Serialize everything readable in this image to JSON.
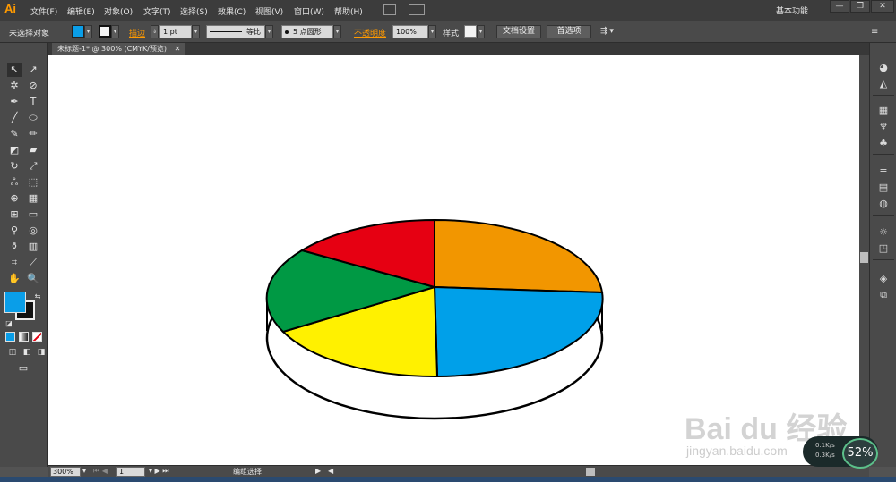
{
  "app": {
    "logo": "Ai"
  },
  "menu": [
    "文件(F)",
    "编辑(E)",
    "对象(O)",
    "文字(T)",
    "选择(S)",
    "效果(C)",
    "视图(V)",
    "窗口(W)",
    "帮助(H)"
  ],
  "workspace": "基本功能",
  "window_controls": [
    "—",
    "❐",
    "✕"
  ],
  "control": {
    "selection_label": "未选择对象",
    "fill_color": "#0a9ee8",
    "stroke_label": "描边",
    "stroke_weight": "1 pt",
    "line_ratio": "等比",
    "brush": "5 点圆形",
    "opacity_label": "不透明度",
    "opacity_value": "100%",
    "style_label": "样式",
    "doc_settings": "文档设置",
    "prefs": "首选项"
  },
  "document_tab": {
    "title": "未标题-1* @ 300% (CMYK/预览)",
    "close": "✕"
  },
  "status": {
    "zoom": "300%",
    "page": "1",
    "status_text": "编组选择"
  },
  "colors": {
    "fill": "#0a9ee8",
    "orange": "#f29600",
    "blue": "#00a0e9",
    "yellow": "#fff100",
    "green": "#009944",
    "red": "#e60012",
    "accent": "#ff9a00"
  },
  "pie_slices": [
    {
      "name": "orange-slice",
      "color": "#f29600"
    },
    {
      "name": "blue-slice",
      "color": "#00a0e9"
    },
    {
      "name": "yellow-slice",
      "color": "#fff100"
    },
    {
      "name": "green-slice",
      "color": "#009944"
    },
    {
      "name": "red-slice",
      "color": "#e60012"
    }
  ],
  "watermark": {
    "main": "Bai du 经验",
    "sub": "jingyan.baidu.com"
  },
  "network_widget": {
    "up": "0.1K/s",
    "down": "0.3K/s",
    "percent": "52%"
  }
}
